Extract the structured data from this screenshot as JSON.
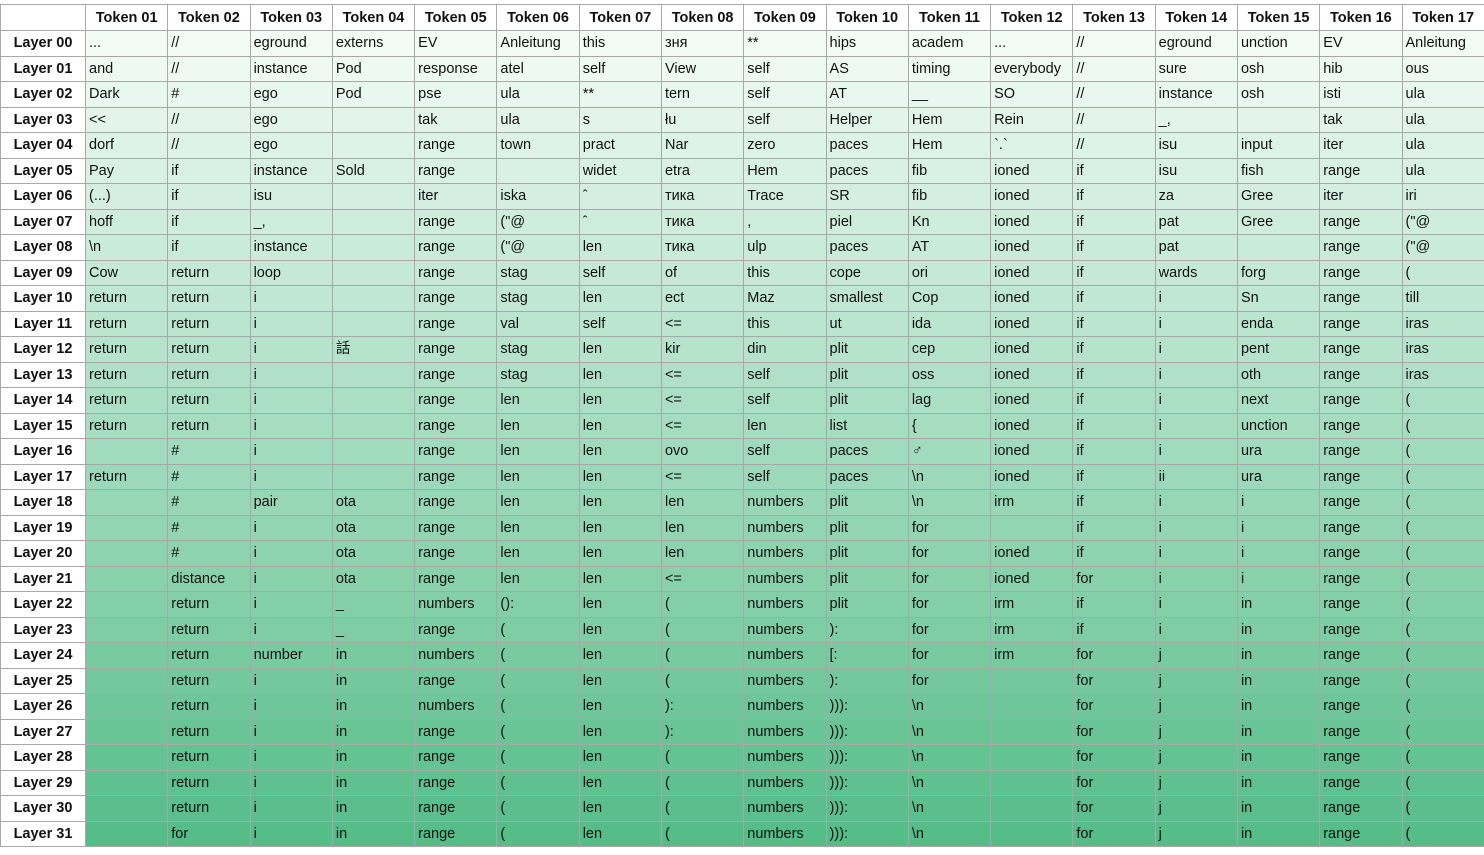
{
  "chart_data": {
    "type": "table",
    "gradient": {
      "start": "#f2fbf6",
      "end": "#55bd88"
    },
    "columns": [
      "Token 01",
      "Token 02",
      "Token 03",
      "Token 04",
      "Token 05",
      "Token 06",
      "Token 07",
      "Token 08",
      "Token 09",
      "Token 10",
      "Token 11",
      "Token 12",
      "Token 13",
      "Token 14",
      "Token 15",
      "Token 16",
      "Token 17"
    ],
    "rows": [
      {
        "label": "Layer 00",
        "cells": [
          "...",
          "//",
          "eground",
          "externs",
          "EV",
          "Anleitung",
          "this",
          "зня",
          "**",
          "hips",
          "academ",
          "...",
          "//",
          "eground",
          "unction",
          "EV",
          "Anleitung"
        ]
      },
      {
        "label": "Layer 01",
        "cells": [
          "and",
          "//",
          "instance",
          "Pod",
          "response",
          "atel",
          "self",
          "View",
          "self",
          "AS",
          "timing",
          "everybody",
          "//",
          "sure",
          "osh",
          "hib",
          "ous"
        ]
      },
      {
        "label": "Layer 02",
        "cells": [
          "Dark",
          "#",
          "ego",
          "Pod",
          "pse",
          "ula",
          "**",
          "tern",
          "self",
          "AT",
          "__",
          "SO",
          "//",
          "instance",
          "osh",
          "isti",
          "ula"
        ]
      },
      {
        "label": "Layer 03",
        "cells": [
          "<<",
          "//",
          "ego",
          "",
          "tak",
          "ula",
          "s",
          "łu",
          "self",
          "Helper",
          "Hem",
          "Rein",
          "//",
          "_,",
          "",
          "tak",
          "ula"
        ]
      },
      {
        "label": "Layer 04",
        "cells": [
          "dorf",
          "//",
          "ego",
          "",
          "range",
          "town",
          "pract",
          "Nar",
          "zero",
          "paces",
          "Hem",
          "`.`",
          "//",
          "isu",
          "input",
          "iter",
          "ula"
        ]
      },
      {
        "label": "Layer 05",
        "cells": [
          "Pay",
          "if",
          "instance",
          "Sold",
          "range",
          "",
          "widet",
          "etra",
          "Hem",
          "paces",
          "fib",
          "ioned",
          "if",
          "isu",
          "fish",
          "range",
          "ula"
        ]
      },
      {
        "label": "Layer 06",
        "cells": [
          "(...)",
          "if",
          "isu",
          "",
          "iter",
          "iska",
          "ˆ",
          "тика",
          "Trace",
          "SR",
          "fib",
          "ioned",
          "if",
          "za",
          "Gree",
          "iter",
          "iri"
        ]
      },
      {
        "label": "Layer 07",
        "cells": [
          "hoff",
          "if",
          "_,",
          "",
          "range",
          "(\"@",
          "ˆ",
          "тика",
          ",",
          "piel",
          "Kn",
          "ioned",
          "if",
          "pat",
          "Gree",
          "range",
          "(\"@"
        ]
      },
      {
        "label": "Layer 08",
        "cells": [
          "\\n",
          "if",
          "instance",
          "",
          "range",
          "(\"@",
          "len",
          "тика",
          "ulp",
          "paces",
          "AT",
          "ioned",
          "if",
          "pat",
          "",
          "range",
          "(\"@"
        ]
      },
      {
        "label": "Layer 09",
        "cells": [
          "Cow",
          "return",
          "loop",
          "",
          "range",
          "stag",
          "self",
          "of",
          "this",
          "cope",
          "ori",
          "ioned",
          "if",
          "wards",
          "forg",
          "range",
          "("
        ]
      },
      {
        "label": "Layer 10",
        "cells": [
          "return",
          "return",
          "i",
          "",
          "range",
          "stag",
          "len",
          "ect",
          "Maz",
          "smallest",
          "Cop",
          "ioned",
          "if",
          "i",
          "Sn",
          "range",
          "till"
        ]
      },
      {
        "label": "Layer 11",
        "cells": [
          "return",
          "return",
          "i",
          "",
          "range",
          "val",
          "self",
          "<=",
          "this",
          "ut",
          "ida",
          "ioned",
          "if",
          "i",
          "enda",
          "range",
          "iras"
        ]
      },
      {
        "label": "Layer 12",
        "cells": [
          "return",
          "return",
          "i",
          "話",
          "range",
          "stag",
          "len",
          "kir",
          "din",
          "plit",
          "cep",
          "ioned",
          "if",
          "i",
          "pent",
          "range",
          "iras"
        ]
      },
      {
        "label": "Layer 13",
        "cells": [
          "return",
          "return",
          "i",
          "",
          "range",
          "stag",
          "len",
          "<=",
          "self",
          "plit",
          "oss",
          "ioned",
          "if",
          "i",
          "oth",
          "range",
          "iras"
        ]
      },
      {
        "label": "Layer 14",
        "cells": [
          "return",
          "return",
          "i",
          "",
          "range",
          "len",
          "len",
          "<=",
          "self",
          "plit",
          "lag",
          "ioned",
          "if",
          "i",
          "next",
          "range",
          "("
        ]
      },
      {
        "label": "Layer 15",
        "cells": [
          "return",
          "return",
          "i",
          "",
          "range",
          "len",
          "len",
          "<=",
          "len",
          "list",
          "{",
          "ioned",
          "if",
          "i",
          "unction",
          "range",
          "("
        ]
      },
      {
        "label": "Layer 16",
        "cells": [
          "",
          "#",
          "i",
          "",
          "range",
          "len",
          "len",
          "ovo",
          "self",
          "paces",
          "♂",
          "ioned",
          "if",
          "i",
          "ura",
          "range",
          "("
        ]
      },
      {
        "label": "Layer 17",
        "cells": [
          "return",
          "#",
          "i",
          "",
          "range",
          "len",
          "len",
          "<=",
          "self",
          "paces",
          "\\n",
          "ioned",
          "if",
          "ii",
          "ura",
          "range",
          "("
        ]
      },
      {
        "label": "Layer 18",
        "cells": [
          "",
          "#",
          "pair",
          "ota",
          "range",
          "len",
          "len",
          "len",
          "numbers",
          "plit",
          "\\n",
          "irm",
          "if",
          "i",
          "i",
          "range",
          "("
        ]
      },
      {
        "label": "Layer 19",
        "cells": [
          "",
          "#",
          "i",
          "ota",
          "range",
          "len",
          "len",
          "len",
          "numbers",
          "plit",
          "for",
          "",
          "if",
          "i",
          "i",
          "range",
          "("
        ]
      },
      {
        "label": "Layer 20",
        "cells": [
          "",
          "#",
          "i",
          "ota",
          "range",
          "len",
          "len",
          "len",
          "numbers",
          "plit",
          "for",
          "ioned",
          "if",
          "i",
          "i",
          "range",
          "("
        ]
      },
      {
        "label": "Layer 21",
        "cells": [
          "",
          "distance",
          "i",
          "ota",
          "range",
          "len",
          "len",
          "<=",
          "numbers",
          "plit",
          "for",
          "ioned",
          "for",
          "i",
          "i",
          "range",
          "("
        ]
      },
      {
        "label": "Layer 22",
        "cells": [
          "",
          "return",
          "i",
          "_",
          "numbers",
          "():",
          "len",
          "(",
          "numbers",
          "plit",
          "for",
          "irm",
          "if",
          "i",
          "in",
          "range",
          "("
        ]
      },
      {
        "label": "Layer 23",
        "cells": [
          "",
          "return",
          "i",
          "_",
          "range",
          "(",
          "len",
          "(",
          "numbers",
          "):",
          "for",
          "irm",
          "if",
          "i",
          "in",
          "range",
          "("
        ]
      },
      {
        "label": "Layer 24",
        "cells": [
          "",
          "return",
          "number",
          "in",
          "numbers",
          "(",
          "len",
          "(",
          "numbers",
          "[:",
          "for",
          "irm",
          "for",
          "j",
          "in",
          "range",
          "("
        ]
      },
      {
        "label": "Layer 25",
        "cells": [
          "",
          "return",
          "i",
          "in",
          "range",
          "(",
          "len",
          "(",
          "numbers",
          "):",
          "for",
          "",
          "for",
          "j",
          "in",
          "range",
          "("
        ]
      },
      {
        "label": "Layer 26",
        "cells": [
          "",
          "return",
          "i",
          "in",
          "numbers",
          "(",
          "len",
          "):",
          "numbers",
          "))):",
          "\\n",
          "",
          "for",
          "j",
          "in",
          "range",
          "("
        ]
      },
      {
        "label": "Layer 27",
        "cells": [
          "",
          "return",
          "i",
          "in",
          "range",
          "(",
          "len",
          "):",
          "numbers",
          "))):",
          "\\n",
          "",
          "for",
          "j",
          "in",
          "range",
          "("
        ]
      },
      {
        "label": "Layer 28",
        "cells": [
          "",
          "return",
          "i",
          "in",
          "range",
          "(",
          "len",
          "(",
          "numbers",
          "))):",
          "\\n",
          "",
          "for",
          "j",
          "in",
          "range",
          "("
        ]
      },
      {
        "label": "Layer 29",
        "cells": [
          "",
          "return",
          "i",
          "in",
          "range",
          "(",
          "len",
          "(",
          "numbers",
          "))):",
          "\\n",
          "",
          "for",
          "j",
          "in",
          "range",
          "("
        ]
      },
      {
        "label": "Layer 30",
        "cells": [
          "",
          "return",
          "i",
          "in",
          "range",
          "(",
          "len",
          "(",
          "numbers",
          "))):",
          "\\n",
          "",
          "for",
          "j",
          "in",
          "range",
          "("
        ]
      },
      {
        "label": "Layer 31",
        "cells": [
          "",
          "for",
          "i",
          "in",
          "range",
          "(",
          "len",
          "(",
          "numbers",
          "))):",
          "\\n",
          "",
          "for",
          "j",
          "in",
          "range",
          "("
        ]
      }
    ]
  }
}
